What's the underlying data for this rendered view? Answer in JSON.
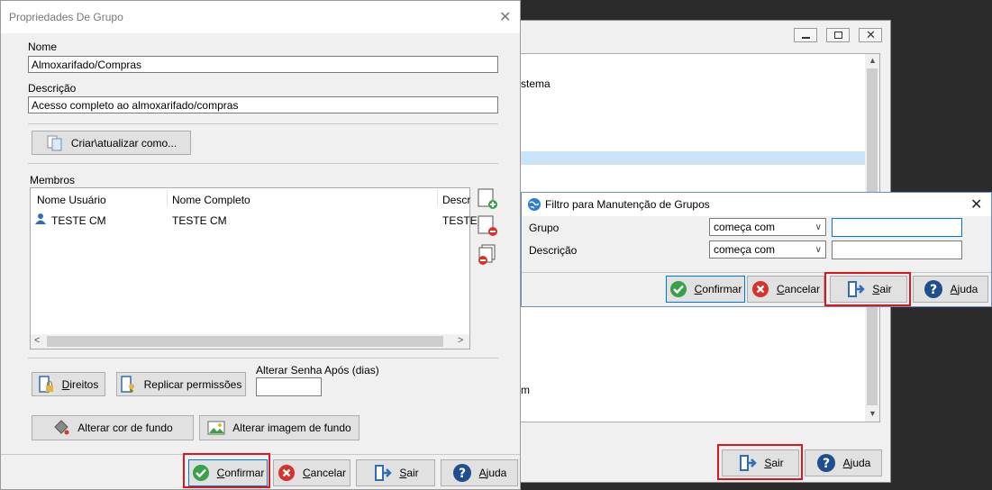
{
  "group_dialog": {
    "title": "Propriedades De Grupo",
    "nome_label": "Nome",
    "nome_value": "Almoxarifado/Compras",
    "descricao_label": "Descrição",
    "descricao_value": "Acesso completo ao almoxarifado/compras",
    "criar_button": "Criar\\atualizar como...",
    "membros_label": "Membros",
    "columns": [
      "Nome Usuário",
      "Nome Completo",
      "Descr"
    ],
    "rows": [
      {
        "usuario": "TESTE CM",
        "completo": "TESTE CM",
        "descr": "TESTE"
      }
    ],
    "direitos_button": "Direitos",
    "replicar_button": "Replicar permissões",
    "alterar_senha_label": "Alterar Senha Após (dias)",
    "alterar_senha_value": "",
    "cor_button": "Alterar cor de fundo",
    "imagem_button": "Alterar imagem de fundo",
    "confirmar": "Confirmar",
    "cancelar": "Cancelar",
    "sair": "Sair",
    "ajuda": "Ajuda"
  },
  "back_window": {
    "list_fragments": [
      "stema",
      "m"
    ],
    "sair": "Sair",
    "ajuda": "Ajuda"
  },
  "filter_dialog": {
    "title": "Filtro para Manutenção de Grupos",
    "grupo_label": "Grupo",
    "grupo_mode": "começa com",
    "grupo_value": "",
    "descricao_label": "Descrição",
    "descricao_mode": "começa com",
    "descricao_value": "",
    "confirmar": "Confirmar",
    "cancelar": "Cancelar",
    "sair": "Sair",
    "ajuda": "Ajuda"
  },
  "colors": {
    "highlight": "#e0141e",
    "accent": "#1a6fc4",
    "selection": "#cce4f7"
  }
}
